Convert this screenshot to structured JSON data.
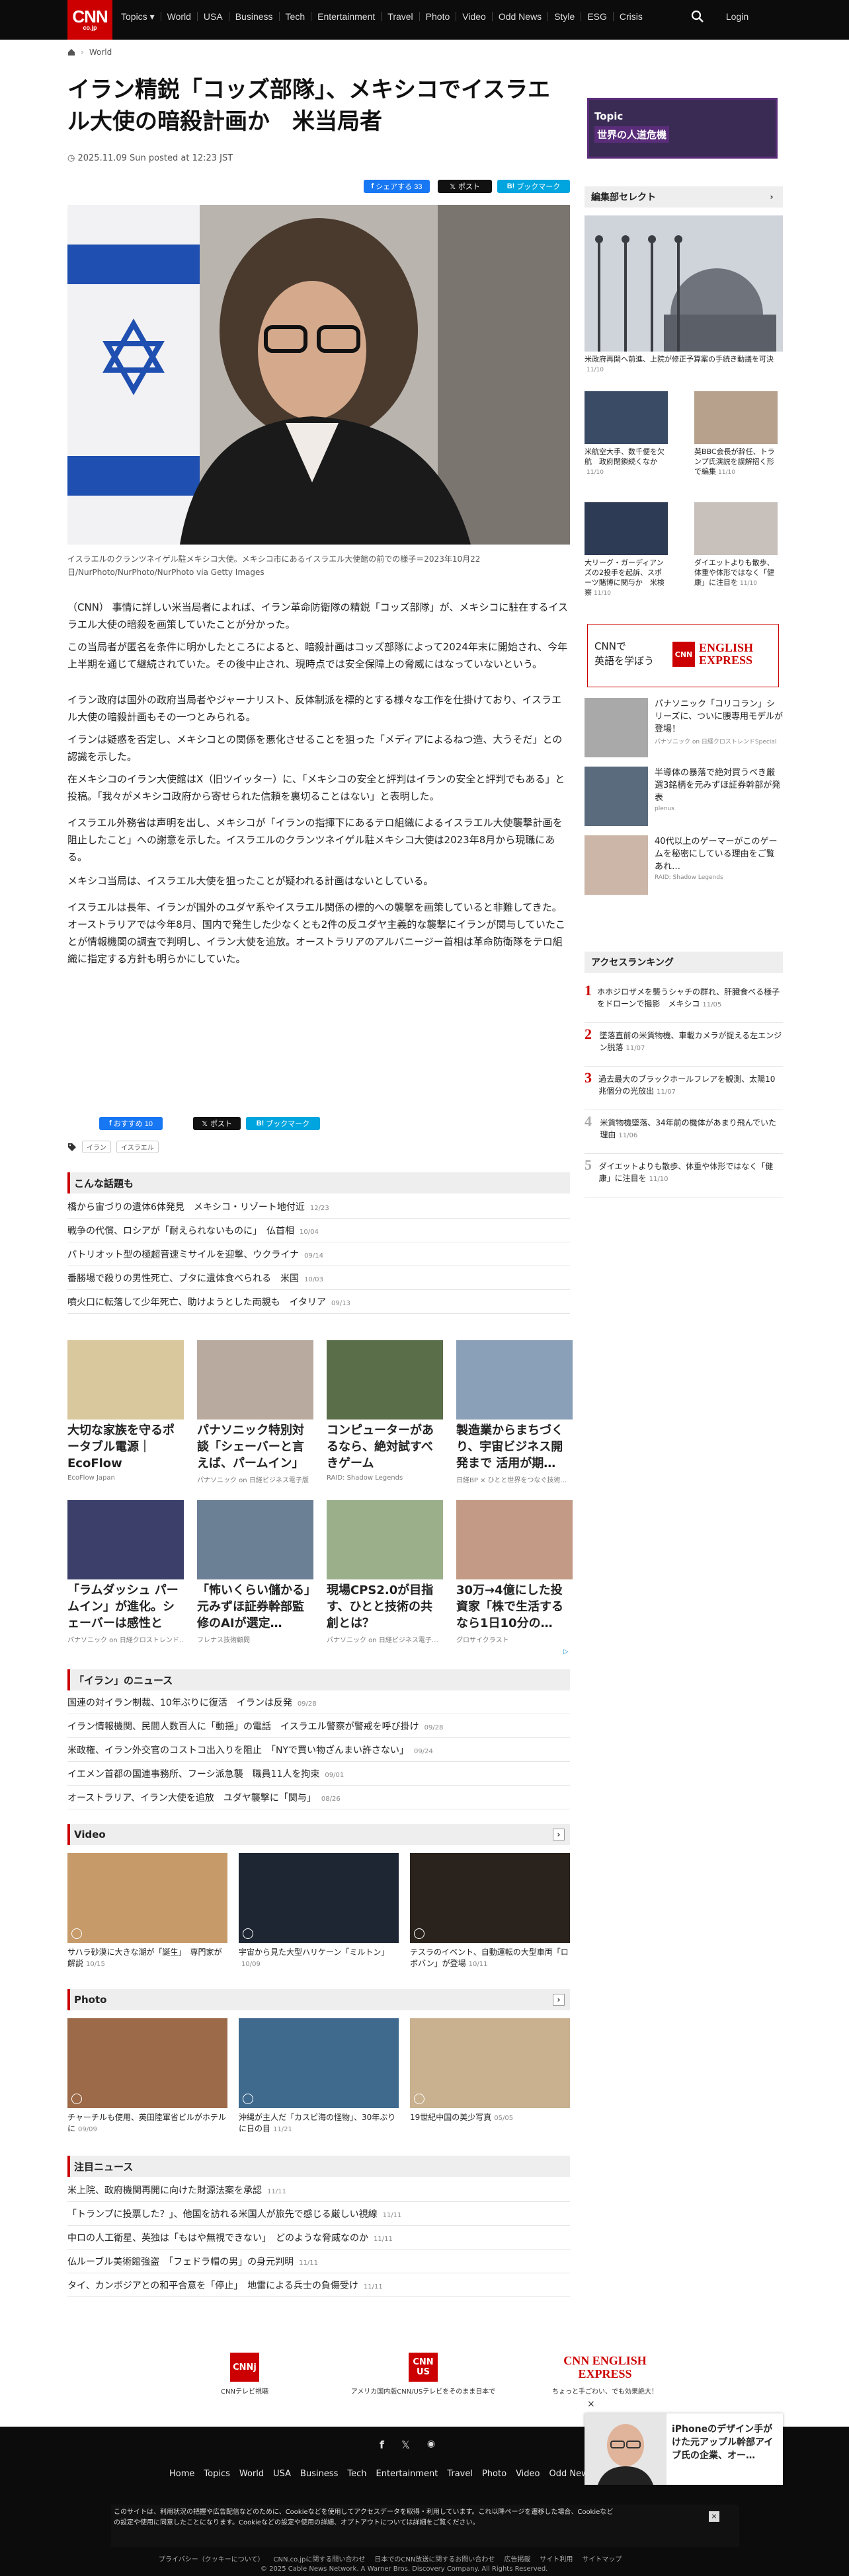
{
  "header": {
    "logo_main": "CNN",
    "logo_sub": "co.jp",
    "nav": [
      "Topics ▾",
      "World",
      "USA",
      "Business",
      "Tech",
      "Entertainment",
      "Travel",
      "Photo",
      "Video",
      "Odd News",
      "Style",
      "ESG",
      "Crisis"
    ],
    "login": "Login"
  },
  "breadcrumb": {
    "section": "World"
  },
  "article": {
    "title": "イラン精鋭「コッズ部隊」、メキシコでイスラエル大使の暗殺計画か　米当局者",
    "date": "2025.11.09 Sun posted at 12:23 JST",
    "share_fb": "シェアする 33",
    "share_x": "ポスト",
    "share_bm": "ブックマーク ",
    "caption": "イスラエルのクランツネイゲル駐メキシコ大使。メキシコ市にあるイスラエル大使館の前での様子＝2023年10月22日/NurPhoto/NurPhoto/NurPhoto via Getty Images",
    "paragraphs": [
      "（CNN） 事情に詳しい米当局者によれば、イラン革命防衛隊の精鋭「コッズ部隊」が、メキシコに駐在するイスラエル大使の暗殺を画策していたことが分かった。",
      "この当局者が匿名を条件に明かしたところによると、暗殺計画はコッズ部隊によって2024年末に開始され、今年上半期を通じて継続されていた。その後中止され、現時点では安全保障上の脅威にはなっていないという。",
      "イラン政府は国外の政府当局者やジャーナリスト、反体制派を標的とする様々な工作を仕掛けており、イスラエル大使の暗殺計画もその一つとみられる。",
      "イランは疑惑を否定し、メキシコとの関係を悪化させることを狙った「メディアによるねつ造、大うそだ」との認識を示した。",
      "在メキシコのイラン大使館はX（旧ツイッター）に、「メキシコの安全と評判はイランの安全と評判でもある」と投稿。「我々がメキシコ政府から寄せられた信頼を裏切ることはない」と表明した。",
      "イスラエル外務省は声明を出し、メキシコが「イランの指揮下にあるテロ組織によるイスラエル大使襲撃計画を阻止したこと」への謝意を示した。イスラエルのクランツネイゲル駐メキシコ大使は2023年8月から現職にある。",
      "メキシコ当局は、イスラエル大使を狙ったことが疑われる計画はないとしている。",
      "イスラエルは長年、イランが国外のユダヤ系やイスラエル関係の標的への襲撃を画策していると非難してきた。オーストラリアでは今年8月、国内で発生した少なくとも2件の反ユダヤ主義的な襲撃にイランが関与していたことが情報機関の調査で判明し、イラン大使を追放。オーストラリアのアルバニージー首相は革命防衛隊をテロ組織に指定する方針も明らかにしていた。"
    ],
    "bottom_fb": "おすすめ 10",
    "bottom_x": "ポスト",
    "bottom_bm": "ブックマーク ",
    "tags": [
      "イラン",
      "イスラエル"
    ]
  },
  "related": {
    "title": "こんな話題も",
    "items": [
      {
        "text": "橋から宙づりの遺体6体発見　メキシコ・リゾート地付近",
        "date": "12/23"
      },
      {
        "text": "戦争の代償、ロシアが「耐えられないものに」　仏首相",
        "date": "10/04"
      },
      {
        "text": "パトリオット型の極超音速ミサイルを迎撃、ウクライナ",
        "date": "09/14"
      },
      {
        "text": "番勝場で殺りの男性死亡、ブタに遺体食べられる　米国",
        "date": "10/03"
      },
      {
        "text": "噴火口に転落して少年死亡、助けようとした両親も　イタリア",
        "date": "09/13"
      }
    ]
  },
  "ads": [
    {
      "title": "大切な家族を守るポータブル電源｜EcoFlow",
      "source": "EcoFlow Japan",
      "color": "#d9c79e"
    },
    {
      "title": "パナソニック特別対談「シェーバーと言えば、パームイン」的…",
      "source": "パナソニック on 日経ビジネス電子版",
      "color": "#b9aaa0"
    },
    {
      "title": "コンピューターがあるなら、絶対試すべきゲーム",
      "source": "RAID: Shadow Legends",
      "color": "#5a6e4a"
    },
    {
      "title": "製造業からまちづくり、宇宙ビジネス開発まで 活用が期…",
      "source": "日経BP × ひとと世界をつなぐ技術…",
      "color": "#8aa0b8"
    },
    {
      "title": "「ラムダッシュ パームイン」が進化。シェーバーは感性とデ…",
      "source": "パナソニック on 日経クロストレンド…",
      "color": "#3b3f6a"
    },
    {
      "title": "「怖いくらい儲かる」元みずほ証券幹部監修のAIが選定…",
      "source": "フレナス技術顧問",
      "color": "#6b7f95"
    },
    {
      "title": "現場CPS2.0が目指す、ひとと技術の共創とは？",
      "source": "パナソニック on 日経ビジネス電子…",
      "color": "#9bb08a"
    },
    {
      "title": "30万→4億にした投資家「株で生活するなら1日10分の…",
      "source": "グロサイクラスト",
      "color": "#c29a86"
    }
  ],
  "iran_news": {
    "title": "「イラン」のニュース",
    "items": [
      {
        "text": "国連の対イラン制裁、10年ぶりに復活　イランは反発",
        "date": "09/28"
      },
      {
        "text": "イラン情報機関、民間人数百人に「動揺」の電話　イスラエル警察が警戒を呼び掛け",
        "date": "09/28"
      },
      {
        "text": "米政権、イラン外交官のコストコ出入りを阻止　「NYで買い物ざんまい許さない」",
        "date": "09/24"
      },
      {
        "text": "イエメン首都の国連事務所、フーシ派急襲　職員11人を拘束",
        "date": "09/01"
      },
      {
        "text": "オーストラリア、イラン大使を追放　ユダヤ襲撃に「関与」",
        "date": "08/26"
      }
    ]
  },
  "video": {
    "title": "Video",
    "items": [
      {
        "text": "サハラ砂漠に大きな湖が「誕生」　専門家が解説",
        "date": "10/15",
        "color": "#c79a6a"
      },
      {
        "text": "宇宙から見た大型ハリケーン「ミルトン」",
        "date": "10/09",
        "color": "#1e2633"
      },
      {
        "text": "テスラのイベント、自動運転の大型車両「ロボバン」が登場",
        "date": "10/11",
        "color": "#2a221c"
      }
    ]
  },
  "photo": {
    "title": "Photo",
    "items": [
      {
        "text": "チャーチルも使用、英田陸軍省ビルがホテルに",
        "date": "09/09",
        "color": "#9c6a48"
      },
      {
        "text": "沖縄が主人だ「カスピ海の怪物」、30年ぶりに日の目",
        "date": "11/21",
        "color": "#3f6a8e"
      },
      {
        "text": "19世紀中国の美少写真",
        "date": "05/05",
        "color": "#c9b08e"
      }
    ]
  },
  "attention": {
    "title": "注目ニュース",
    "items": [
      {
        "text": "米上院、政府機関再開に向けた財源法案を承認",
        "date": "11/11"
      },
      {
        "text": "「トランプに投票した？」、他国を訪れる米国人が旅先で感じる厳しい視線",
        "date": "11/11"
      },
      {
        "text": "中ロの人工衛星、英独は「もはや無視できない」　どのような脅威なのか",
        "date": "11/11"
      },
      {
        "text": "仏ルーブル美術館強盗　「フェドラ帽の男」の身元判明",
        "date": "11/11"
      },
      {
        "text": "タイ、カンボジアとの和平合意を「停止」　地雷による兵士の負傷受け",
        "date": "11/11"
      }
    ]
  },
  "sidebar": {
    "topic_label": "Topic",
    "topic_title": "世界の人道危機",
    "editor_title": "編集部セレクト",
    "editor_main": {
      "text": "米政府再開へ前進、上院が修正予算案の手続き動議を可決",
      "date": "11/10"
    },
    "editor_small": [
      {
        "text": "米航空大手、数千便を欠航　政府閉鎖続くなか",
        "date": "11/10",
        "color": "#3a4b66"
      },
      {
        "text": "英BBC会長が辞任、トランプ氏演説を誤解招く形で編集",
        "date": "11/10",
        "color": "#b7a08c"
      },
      {
        "text": "大リーグ・ガーディアンズの2投手を起訴、スポーツ賭博に関与か　米検察",
        "date": "11/10",
        "color": "#2e3b55"
      },
      {
        "text": "ダイエットよりも散歩、体重や体形ではなく「健康」に注目を",
        "date": "11/10",
        "color": "#c7c0bb"
      }
    ],
    "english_banner": {
      "line1": "CNNで",
      "line2": "英語を学ぼう",
      "brand1": "CNN",
      "brand2": "ENGLISH EXPRESS"
    },
    "sponsored": [
      {
        "text": "パナソニック「コリコラン」シリーズに、ついに腰専用モデルが登場！",
        "source": "パナソニック on 日経クロストレンドSpecial",
        "color": "#a9a9a9"
      },
      {
        "text": "半導体の暴落で絶対買うべき厳選3銘柄を元みずほ証券幹部が発表",
        "source": "plenus",
        "color": "#5b6b7e"
      },
      {
        "text": "40代以上のゲーマーがこのゲームを秘密にしている理由をご覧あれ…",
        "source": "RAID: Shadow Legends",
        "color": "#cbb6a8"
      }
    ],
    "ranking_title": "アクセスランキング",
    "ranking": [
      {
        "n": "1",
        "text": "ホホジロザメを襲うシャチの群れ、肝臓食べる様子をドローンで撮影　メキシコ",
        "date": "11/05"
      },
      {
        "n": "2",
        "text": "墜落直前の米貨物機、車載カメラが捉える左エンジン脱落",
        "date": "11/07"
      },
      {
        "n": "3",
        "text": "過去最大のブラックホールフレアを観測、太陽10兆個分の光放出",
        "date": "11/07"
      },
      {
        "n": "4",
        "text": "米貨物機墜落、34年前の機体があまり飛んでいた理由",
        "date": "11/06"
      },
      {
        "n": "5",
        "text": "ダイエットよりも散歩、体重や体形ではなく「健康」に注目を",
        "date": "11/10"
      }
    ]
  },
  "footer": {
    "logo1_caption": "CNNテレビ視聴",
    "logo2_caption": "アメリカ国内版CNN/USテレビをそのまま日本で",
    "logo3_caption": "ちょっと手ごわい、でも効果絶大！",
    "nav": [
      "Home",
      "Topics",
      "World",
      "USA",
      "Business",
      "Tech",
      "Entertainment",
      "Travel",
      "Photo",
      "Video",
      "Odd News"
    ],
    "cookie": "このサイトは、利用状況の把握や広告配信などのために、Cookieなどを使用してアクセスデータを取得・利用しています。これ以降ページを遷移した場合、Cookieなどの設定や使用に同意したことになります。Cookieなどの設定や使用の詳細、オプトアウトについては詳細をご覧ください。",
    "links": [
      "プライバシー（クッキーについて）",
      "CNN.co.jpに関する問い合わせ",
      "日本でのCNN放送に関するお問い合わせ",
      "広告掲載",
      "サイト利用",
      "サイトマップ"
    ],
    "copyright": "© 2025 Cable News Network. A Warner Bros. Discovery Company. All Rights Reserved.",
    "popup_text": "iPhoneのデザイン手がけた元アップル幹部アイブ氏の企業、オー…"
  }
}
